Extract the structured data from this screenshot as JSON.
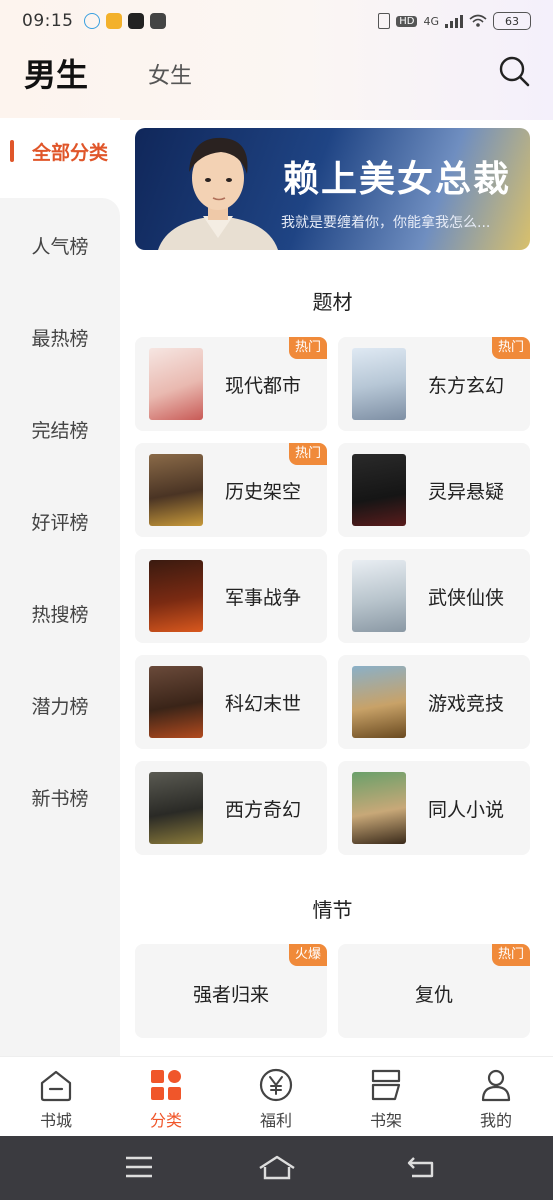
{
  "status_bar": {
    "time": "09:15",
    "network": "4G",
    "hd": "HD",
    "battery": "63"
  },
  "header": {
    "tab_active": "男生",
    "tab_other": "女生",
    "search_icon": "search-icon"
  },
  "sidebar": {
    "active": "全部分类",
    "items": [
      "人气榜",
      "最热榜",
      "完结榜",
      "好评榜",
      "热搜榜",
      "潜力榜",
      "新书榜"
    ]
  },
  "banner": {
    "title": "赖上美女总裁",
    "subtitle": "我就是要缠着你，你能拿我怎么..."
  },
  "sections": {
    "genre_title": "题材",
    "genres": [
      {
        "name": "现代都市",
        "badge": "热门"
      },
      {
        "name": "东方玄幻",
        "badge": "热门"
      },
      {
        "name": "历史架空",
        "badge": "热门"
      },
      {
        "name": "灵异悬疑",
        "badge": ""
      },
      {
        "name": "军事战争",
        "badge": ""
      },
      {
        "name": "武侠仙侠",
        "badge": ""
      },
      {
        "name": "科幻末世",
        "badge": ""
      },
      {
        "name": "游戏竞技",
        "badge": ""
      },
      {
        "name": "西方奇幻",
        "badge": ""
      },
      {
        "name": "同人小说",
        "badge": ""
      }
    ],
    "plot_title": "情节",
    "plots": [
      {
        "name": "强者归来",
        "badge": "火爆"
      },
      {
        "name": "复仇",
        "badge": "热门"
      }
    ]
  },
  "bottom_nav": {
    "items": [
      {
        "label": "书城",
        "icon": "home-icon"
      },
      {
        "label": "分类",
        "icon": "category-icon"
      },
      {
        "label": "福利",
        "icon": "yen-coin-icon"
      },
      {
        "label": "书架",
        "icon": "bookshelf-icon"
      },
      {
        "label": "我的",
        "icon": "profile-icon"
      }
    ],
    "active_index": 1
  },
  "colors": {
    "accent": "#e0562a",
    "badge": "#f08a3a",
    "sidebar_bg": "#f4f4f4",
    "card_bg": "#f5f5f5"
  }
}
